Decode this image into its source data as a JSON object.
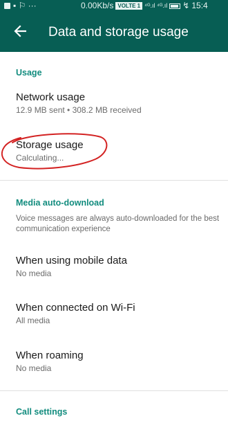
{
  "statusbar": {
    "left_icons": "▪ ⚐ ···",
    "speed": "0.00Kb/s",
    "volte": "VOLTE 1",
    "signal": "⁴ᴳ.ıl ⁴ᴳ.ıl",
    "charge": "↯",
    "time": "15:4"
  },
  "appbar": {
    "back_icon": "arrow-left-icon",
    "title": "Data and storage usage"
  },
  "usage": {
    "header": "Usage",
    "network": {
      "title": "Network usage",
      "subtitle": "12.9 MB sent • 308.2 MB received"
    },
    "storage": {
      "title": "Storage usage",
      "subtitle": "Calculating..."
    }
  },
  "media": {
    "header": "Media auto-download",
    "note": "Voice messages are always auto-downloaded for the best communication experience",
    "mobile": {
      "title": "When using mobile data",
      "subtitle": "No media"
    },
    "wifi": {
      "title": "When connected on Wi-Fi",
      "subtitle": "All media"
    },
    "roaming": {
      "title": "When roaming",
      "subtitle": "No media"
    }
  },
  "call": {
    "header": "Call settings"
  },
  "colors": {
    "primary": "#075e54",
    "accent": "#128c7e",
    "annotation": "#d32222"
  }
}
